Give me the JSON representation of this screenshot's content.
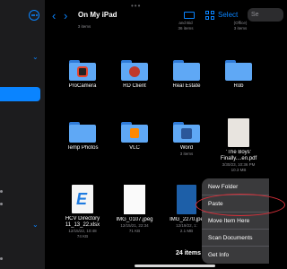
{
  "header": {
    "title": "On My iPad",
    "select_label": "Select",
    "search_placeholder": "Se"
  },
  "files": [
    {
      "name": "ProCamera",
      "kind": "folder",
      "meta": "",
      "badge_color": "#e8442c"
    },
    {
      "name": "RD Client",
      "kind": "folder",
      "meta": "",
      "badge_color": "#c0392b"
    },
    {
      "name": "Real Estate",
      "kind": "folder",
      "meta": ""
    },
    {
      "name": "Rob",
      "kind": "folder",
      "meta": ""
    },
    {
      "name": "Temp Photos",
      "kind": "folder",
      "meta": ""
    },
    {
      "name": "VLC",
      "kind": "folder",
      "meta": "",
      "badge_color": "#ff8800"
    },
    {
      "name": "Word",
      "kind": "folder",
      "meta": "3 items",
      "badge_color": "#2b579a"
    },
    {
      "name": "'The Boys' Finally....en.pdf",
      "kind": "pdf",
      "meta": "3/30/23, 10:36 PM\n10.3 MB"
    },
    {
      "name": "HCV Directory 11_13_22.xlsx",
      "kind": "xlsx",
      "meta": "12/15/22, 10:48\n74 KB"
    },
    {
      "name": "IMG_0107.jpeg",
      "kind": "image",
      "meta": "12/15/21, 22:34\n71 KB"
    },
    {
      "name": "IMG_2270.jpe",
      "kind": "image",
      "meta": "12/19/22, 1:\n2.1 MB"
    },
    {
      "name": "",
      "kind": "image",
      "meta": ""
    }
  ],
  "top_row_partial": [
    "3 items",
    "",
    "and Bid\n36 items",
    "(Office)\n3 items"
  ],
  "footer": {
    "item_count": "24 items"
  },
  "context_menu": {
    "items": [
      "New Folder",
      "Paste",
      "Move Item Here",
      "Scan Documents",
      "Get Info"
    ]
  },
  "colors": {
    "accent": "#0a84ff",
    "folder": "#5fa8f5",
    "annotation": "#d6303a"
  }
}
